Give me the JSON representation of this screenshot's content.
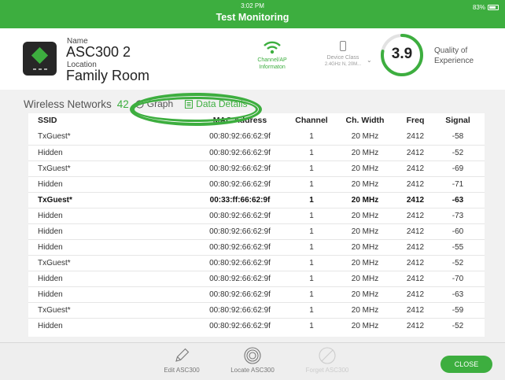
{
  "status": {
    "time": "3:02 PM",
    "battery": "83%",
    "battery_level": 0.83
  },
  "app": {
    "title": "Test Monitoring"
  },
  "device": {
    "name_label": "Name",
    "name": "ASC300 2",
    "location_label": "Location",
    "location": "Family Room",
    "channel_ap_line1": "Channel/AP",
    "channel_ap_line2": "Informaton",
    "device_class_label": "Device Class",
    "device_class_value": "2.4GHz N, 20M...",
    "qoe_score": "3.9",
    "qoe_fraction": 0.78,
    "qoe_label_line1": "Quality of",
    "qoe_label_line2": "Experience"
  },
  "section": {
    "title": "Wireless Networks",
    "count": "42",
    "tab_graph": "Graph",
    "tab_details": "Data Details"
  },
  "table": {
    "headers": {
      "ssid": "SSID",
      "mac": "MAC Address",
      "channel": "Channel",
      "width": "Ch. Width",
      "freq": "Freq",
      "signal": "Signal"
    },
    "rows": [
      {
        "ssid": "TxGuest*",
        "mac": "00:80:92:66:62:9f",
        "channel": "1",
        "width": "20 MHz",
        "freq": "2412",
        "signal": "-58"
      },
      {
        "ssid": "Hidden",
        "mac": "00:80:92:66:62:9f",
        "channel": "1",
        "width": "20 MHz",
        "freq": "2412",
        "signal": "-52"
      },
      {
        "ssid": "TxGuest*",
        "mac": "00:80:92:66:62:9f",
        "channel": "1",
        "width": "20 MHz",
        "freq": "2412",
        "signal": "-69"
      },
      {
        "ssid": "Hidden",
        "mac": "00:80:92:66:62:9f",
        "channel": "1",
        "width": "20 MHz",
        "freq": "2412",
        "signal": "-71"
      },
      {
        "ssid": "TxGuest*",
        "mac": "00:33:ff:66:62:9f",
        "channel": "1",
        "width": "20 MHz",
        "freq": "2412",
        "signal": "-63"
      },
      {
        "ssid": "Hidden",
        "mac": "00:80:92:66:62:9f",
        "channel": "1",
        "width": "20 MHz",
        "freq": "2412",
        "signal": "-73"
      },
      {
        "ssid": "Hidden",
        "mac": "00:80:92:66:62:9f",
        "channel": "1",
        "width": "20 MHz",
        "freq": "2412",
        "signal": "-60"
      },
      {
        "ssid": "Hidden",
        "mac": "00:80:92:66:62:9f",
        "channel": "1",
        "width": "20 MHz",
        "freq": "2412",
        "signal": "-55"
      },
      {
        "ssid": "TxGuest*",
        "mac": "00:80:92:66:62:9f",
        "channel": "1",
        "width": "20 MHz",
        "freq": "2412",
        "signal": "-52"
      },
      {
        "ssid": "Hidden",
        "mac": "00:80:92:66:62:9f",
        "channel": "1",
        "width": "20 MHz",
        "freq": "2412",
        "signal": "-70"
      },
      {
        "ssid": "Hidden",
        "mac": "00:80:92:66:62:9f",
        "channel": "1",
        "width": "20 MHz",
        "freq": "2412",
        "signal": "-63"
      },
      {
        "ssid": "TxGuest*",
        "mac": "00:80:92:66:62:9f",
        "channel": "1",
        "width": "20 MHz",
        "freq": "2412",
        "signal": "-59"
      },
      {
        "ssid": "Hidden",
        "mac": "00:80:92:66:62:9f",
        "channel": "1",
        "width": "20 MHz",
        "freq": "2412",
        "signal": "-52"
      }
    ]
  },
  "bottom": {
    "edit_label": "Edit ASC300",
    "locate_label": "Locate ASC300",
    "forget_label": "Forget ASC300",
    "close_label": "CLOSE"
  },
  "icons": {
    "wifi": "wifi-icon",
    "device_class": "phone-icon",
    "graph": "graph-icon",
    "details": "list-icon",
    "edit": "pencil-icon",
    "locate": "target-icon",
    "forget": "no-entry-icon"
  },
  "colors": {
    "accent": "#3dae3f",
    "device_icon": "#272727"
  }
}
